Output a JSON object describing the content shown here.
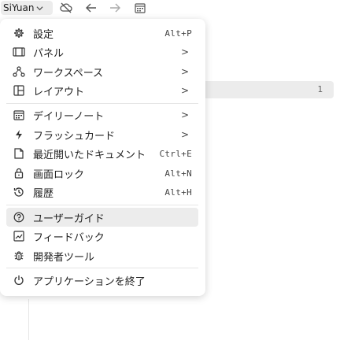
{
  "toolbar": {
    "app_name": "SiYuan"
  },
  "background": {
    "row_count": "1"
  },
  "menu": {
    "items": [
      {
        "label": "設定",
        "shortcut": "Alt+P"
      },
      {
        "label": "パネル"
      },
      {
        "label": "ワークスペース"
      },
      {
        "label": "レイアウト"
      },
      {
        "label": "デイリーノート"
      },
      {
        "label": "フラッシュカード"
      },
      {
        "label": "最近開いたドキュメント",
        "shortcut": "Ctrl+E"
      },
      {
        "label": "画面ロック",
        "shortcut": "Alt+N"
      },
      {
        "label": "履歴",
        "shortcut": "Alt+H"
      },
      {
        "label": "ユーザーガイド"
      },
      {
        "label": "フィードバック"
      },
      {
        "label": "開発者ツール"
      },
      {
        "label": "アプリケーションを終了"
      }
    ],
    "submenu_arrow": ">"
  }
}
